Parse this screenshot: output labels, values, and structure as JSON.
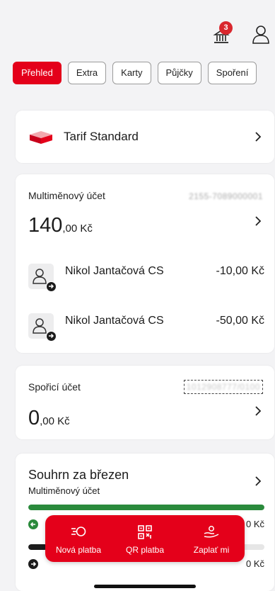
{
  "header": {
    "notifications_count": "3",
    "bank_icon": "bank-icon",
    "profile_icon": "user-icon"
  },
  "tabs": [
    {
      "label": "Přehled",
      "active": true
    },
    {
      "label": "Extra"
    },
    {
      "label": "Karty"
    },
    {
      "label": "Půjčky"
    },
    {
      "label": "Spoření"
    }
  ],
  "tarif": {
    "name": "Tarif Standard"
  },
  "multi_account": {
    "label": "Multiměnový účet",
    "account_number": "2155-7089000001",
    "balance_int": "140",
    "balance_dec": ",00 Kč",
    "transactions": [
      {
        "name": "Nikol Jantačová CS",
        "amount": "-10,00 Kč"
      },
      {
        "name": "Nikol Jantačová CS",
        "amount": "-50,00 Kč"
      }
    ]
  },
  "savings_account": {
    "label": "Spořicí účet",
    "account_number": "1012908777/0100",
    "balance_int": "0",
    "balance_dec": ",00 Kč"
  },
  "summary": {
    "title": "Souhrn za březen",
    "subtitle": "Multiměnový účet",
    "income_amount": "0 Kč",
    "expense_amount": "0 Kč",
    "income_fill": 1.0,
    "expense_fill": 0.08
  },
  "actions": [
    {
      "label": "Nová platba",
      "icon": "new-payment-icon"
    },
    {
      "label": "QR platba",
      "icon": "qr-code-icon"
    },
    {
      "label": "Zaplať mi",
      "icon": "request-payment-icon"
    }
  ],
  "colors": {
    "accent": "#e4001a",
    "income": "#2a8a3c",
    "expense": "#1c1c1c"
  }
}
